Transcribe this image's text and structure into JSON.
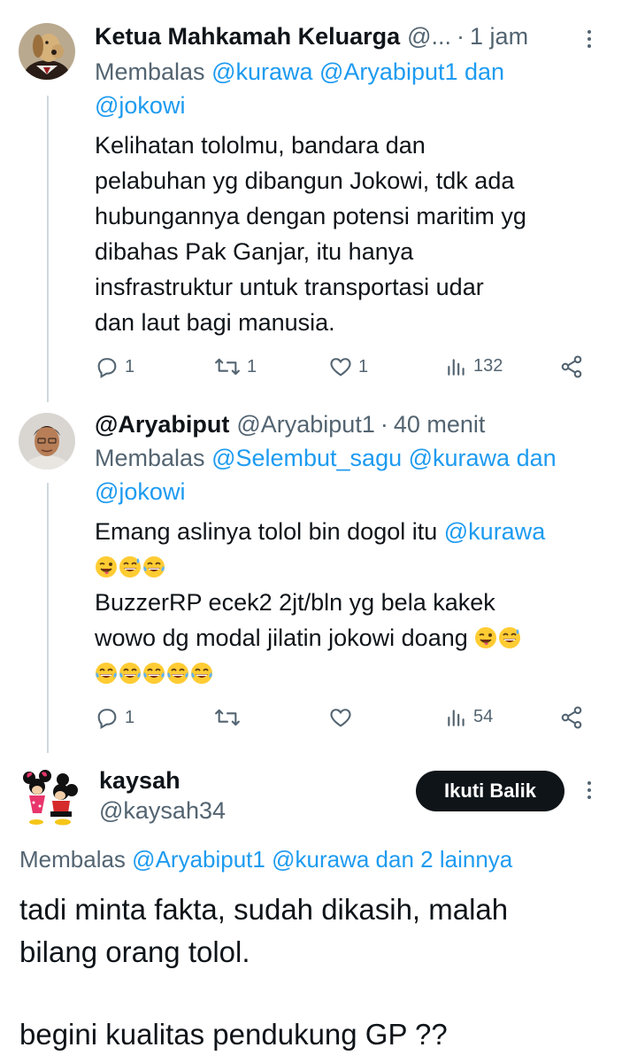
{
  "tweets": [
    {
      "name": "Ketua Mahkamah Keluarga",
      "handle": "@...",
      "time": "1 jam",
      "reply_prefix": "Membalas",
      "reply_mentions_1": "@kurawa @Aryabiput1",
      "reply_join": "dan",
      "reply_mentions_2": "@jokowi",
      "lines": [
        "Kelihatan tololmu, bandara dan",
        "pelabuhan yg dibangun Jokowi, tdk ada",
        "hubungannya dengan potensi maritim yg",
        "dibahas Pak Ganjar, itu hanya",
        "insfrastruktur untuk transportasi udar",
        "dan laut bagi manusia."
      ],
      "replies": "1",
      "retweets": "1",
      "likes": "1",
      "views": "132"
    },
    {
      "name": "@Aryabiput",
      "handle": "@Aryabiput1",
      "time": "40 menit",
      "reply_prefix": "Membalas",
      "reply_mentions_1": "@Selembut_sagu @kurawa",
      "reply_join": "dan",
      "reply_mentions_2": "@jokowi",
      "line1": "Emang aslinya tolol bin dogol itu",
      "line1_mention": "@kurawa",
      "line3": "BuzzerRP ecek2 2jt/bln yg bela kakek",
      "line4": "wowo dg modal jilatin jokowi doang",
      "replies": "1",
      "views": "54"
    },
    {
      "name": "kaysah",
      "handle": "@kaysah34",
      "follow_label": "Ikuti Balik",
      "reply_prefix": "Membalas",
      "reply_mentions_1": "@Aryabiput1 @kurawa",
      "reply_join": "dan",
      "reply_mentions_2": "2 lainnya",
      "line1": "tadi minta fakta, sudah dikasih, malah",
      "line2": "bilang orang tolol.",
      "line3": "begini kualitas pendukung GP ??"
    }
  ],
  "icons": {
    "reply": "reply-icon",
    "retweet": "retweet-icon",
    "like": "heart-icon",
    "views": "views-icon",
    "share": "share-icon",
    "more": "more-icon",
    "emoji_wink": "winking-face-with-tongue-icon",
    "emoji_sweat": "grinning-face-with-sweat-icon",
    "emoji_joy": "face-with-tears-of-joy-icon"
  },
  "colors": {
    "text": "#0f1419",
    "secondary": "#536471",
    "link": "#1d9bf0",
    "button": "#0f1419"
  }
}
